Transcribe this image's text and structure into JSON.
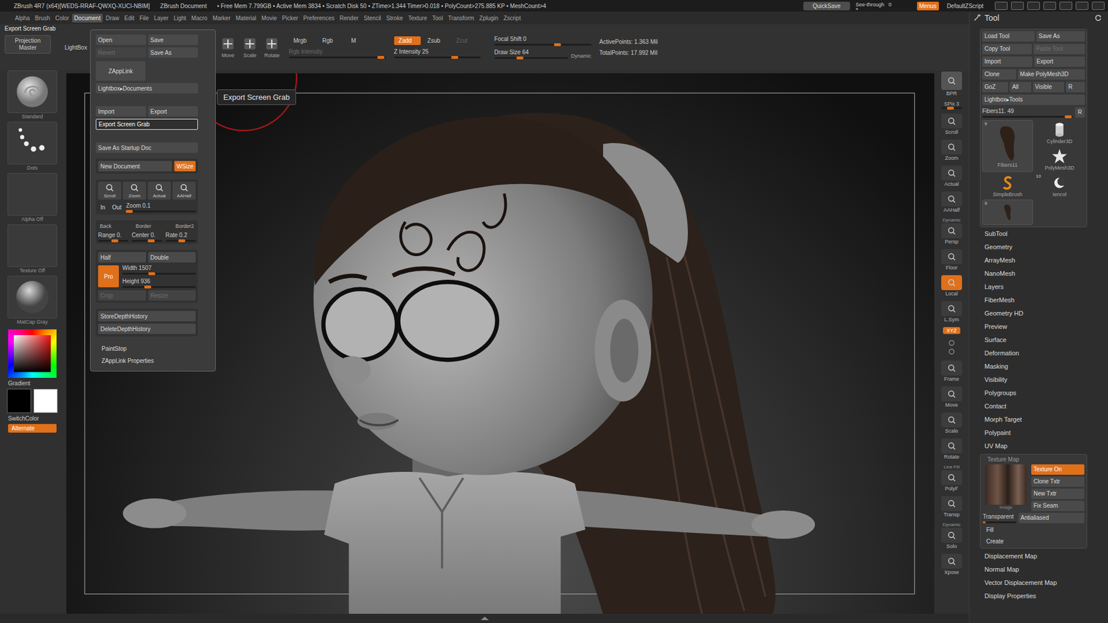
{
  "title_bar": {
    "app": "ZBrush 4R7 (x64)[WEDS-RRAF-QWXQ-XUCI-NBIM]",
    "document": "ZBrush Document",
    "stats": "• Free Mem 7.799GB • Active Mem 3834 • Scratch Disk 50 • ZTime>1.344 Timer>0.018 • PolyCount>275.885 KP • MeshCount>4",
    "quicksave": "QuickSave",
    "see_through": {
      "label": "See-through",
      "value": "0",
      "level": 0.05
    },
    "menus": {
      "label": "Menus",
      "on": true
    },
    "script": "DefaultZScript"
  },
  "menu_bar": [
    {
      "label": "Alpha",
      "selected": false
    },
    {
      "label": "Brush",
      "selected": false
    },
    {
      "label": "Color",
      "selected": false
    },
    {
      "label": "Document",
      "selected": true
    },
    {
      "label": "Draw",
      "selected": false
    },
    {
      "label": "Edit",
      "selected": false
    },
    {
      "label": "File",
      "selected": false
    },
    {
      "label": "Layer",
      "selected": false
    },
    {
      "label": "Light",
      "selected": false
    },
    {
      "label": "Macro",
      "selected": false
    },
    {
      "label": "Marker",
      "selected": false
    },
    {
      "label": "Material",
      "selected": false
    },
    {
      "label": "Movie",
      "selected": false
    },
    {
      "label": "Picker",
      "selected": false
    },
    {
      "label": "Preferences",
      "selected": false
    },
    {
      "label": "Render",
      "selected": false
    },
    {
      "label": "Stencil",
      "selected": false
    },
    {
      "label": "Stroke",
      "selected": false
    },
    {
      "label": "Texture",
      "selected": false
    },
    {
      "label": "Tool",
      "selected": false
    },
    {
      "label": "Transform",
      "selected": false
    },
    {
      "label": "Zplugin",
      "selected": false
    },
    {
      "label": "Zscript",
      "selected": false
    }
  ],
  "shelf": {
    "palette_title": "Export Screen Grab",
    "projection_master": "Projection Master",
    "lightbox": "LightBox",
    "transform_buttons": [
      {
        "label": "Move",
        "selected": false
      },
      {
        "label": "Scale",
        "selected": false
      },
      {
        "label": "Rotate",
        "selected": false
      }
    ],
    "color_modes": [
      {
        "label": "Mrgb",
        "selected": false
      },
      {
        "label": "Rgb",
        "selected": false
      },
      {
        "label": "M",
        "selected": false
      }
    ],
    "rgb_intensity": {
      "label": "Rgb Intensity",
      "disabled": true,
      "level": 0.95
    },
    "z_modes": [
      {
        "label": "Zadd",
        "selected": true,
        "disabled": false
      },
      {
        "label": "Zsub",
        "selected": false,
        "disabled": false
      },
      {
        "label": "Zcut",
        "selected": false,
        "disabled": true
      }
    ],
    "z_intensity": {
      "label": "Z Intensity",
      "value": "25",
      "level": 0.7
    },
    "focal_shift": {
      "label": "Focal Shift",
      "value": "0",
      "level": 0.65
    },
    "draw_size": {
      "label": "Draw Size",
      "value": "64",
      "level": 0.35
    },
    "dynamic": "Dynamic",
    "points": [
      "ActivePoints: 1.363 Mil",
      "TotalPoints: 17.992 Mil"
    ]
  },
  "left_shelf": {
    "items": [
      {
        "label": "Standard",
        "kind": "brush"
      },
      {
        "label": "Dots",
        "kind": "stroke"
      },
      {
        "label": "Alpha Off",
        "kind": "empty"
      },
      {
        "label": "Texture Off",
        "kind": "empty"
      },
      {
        "label": "MatCap Gray",
        "kind": "material"
      }
    ],
    "gradient": "Gradient",
    "main_color": "#000000",
    "secondary_color": "#ffffff",
    "switch_color": "SwitchColor",
    "alternate": {
      "label": "Alternate",
      "on": true
    }
  },
  "canvas": {
    "tooltip": "Export Screen Grab"
  },
  "right_bar": [
    {
      "label": "BPR",
      "kind": "big",
      "on": false
    },
    {
      "label": "SPix 3",
      "kind": "slider",
      "level": 0.45
    },
    {
      "label": "Scroll",
      "kind": "button",
      "on": false
    },
    {
      "label": "Zoom",
      "kind": "button",
      "on": false
    },
    {
      "label": "Actual",
      "kind": "button",
      "on": false
    },
    {
      "label": "AAHalf",
      "kind": "button",
      "on": false
    },
    {
      "top": "Dynamic",
      "label": "Persp",
      "kind": "button",
      "on": false
    },
    {
      "label": "Floor",
      "kind": "button",
      "on": false
    },
    {
      "label": "Local",
      "kind": "button",
      "on": true
    },
    {
      "label": "L.Sym",
      "kind": "button",
      "on": false
    },
    {
      "label": "XYZ",
      "kind": "pill",
      "on": true
    },
    {
      "kind": "icons",
      "on": false
    },
    {
      "label": "Frame",
      "kind": "button",
      "on": false
    },
    {
      "label": "Move",
      "kind": "button",
      "on": false
    },
    {
      "label": "Scale",
      "kind": "button",
      "on": false
    },
    {
      "label": "Rotate",
      "kind": "button",
      "on": false
    },
    {
      "top": "Line Fill",
      "label": "PolyF",
      "kind": "button",
      "on": false
    },
    {
      "label": "Transp",
      "kind": "button",
      "on": false
    },
    {
      "top": "Dynamic",
      "label": "Solo",
      "kind": "button",
      "on": false
    },
    {
      "label": "Xpose",
      "kind": "button",
      "on": false
    }
  ],
  "document_menu": {
    "file_buttons": [
      {
        "label": "Open",
        "disabled": false
      },
      {
        "label": "Save",
        "disabled": false
      },
      {
        "label": "Revert",
        "disabled": true
      },
      {
        "label": "Save As",
        "disabled": false
      }
    ],
    "zapplink": "ZAppLink",
    "lightbox": "Lightbox▸Documents",
    "io_buttons": [
      "Import",
      "Export"
    ],
    "export_screen_grab": {
      "label": "Export Screen Grab",
      "highlighted": true
    },
    "startup": "Save As Startup Doc",
    "new_document": "New Document",
    "wsize": {
      "label": "WSize",
      "on": true
    },
    "view_buttons": [
      "Scroll",
      "Zoom",
      "Actual",
      "AAHalf"
    ],
    "zoom_in": "In",
    "zoom_out": "Out",
    "zoom": {
      "label": "Zoom",
      "value": "0.1",
      "level": 0.05
    },
    "border_labels": [
      "Back",
      "Border",
      "Border2"
    ],
    "range_sliders": [
      {
        "label": "Range",
        "value": "0.",
        "level": 0.55
      },
      {
        "label": "Center",
        "value": "0.",
        "level": 0.65
      },
      {
        "label": "Rate",
        "value": "0.2",
        "level": 0.55
      }
    ],
    "half_double": [
      "Half",
      "Double"
    ],
    "pro": {
      "label": "Pro",
      "on": true
    },
    "size_sliders": [
      {
        "label": "Width",
        "value": "1507",
        "level": 0.4
      },
      {
        "label": "Height",
        "value": "936",
        "level": 0.35
      }
    ],
    "crop_resize": [
      {
        "label": "Crop",
        "disabled": true
      },
      {
        "label": "Resize",
        "disabled": true
      }
    ],
    "depth_buttons": [
      "StoreDepthHistory",
      "DeleteDepthHistory"
    ],
    "links": [
      "PaintStop",
      "ZAppLink Properties"
    ]
  },
  "tool_panel": {
    "title": "Tool",
    "button_rows": [
      [
        {
          "label": "Load Tool",
          "disabled": false
        },
        {
          "label": "Save As",
          "disabled": false
        }
      ],
      [
        {
          "label": "Copy Tool",
          "disabled": false
        },
        {
          "label": "Paste Tool",
          "disabled": true
        }
      ],
      [
        {
          "label": "Import",
          "disabled": false
        },
        {
          "label": "Export",
          "disabled": false
        }
      ],
      [
        {
          "label": "Clone",
          "disabled": false
        },
        {
          "label": "Make PolyMesh3D",
          "disabled": false
        }
      ],
      [
        {
          "label": "GoZ",
          "disabled": false
        },
        {
          "label": "All",
          "disabled": false
        },
        {
          "label": "Visible",
          "disabled": false
        },
        {
          "label": "R",
          "disabled": false
        }
      ]
    ],
    "lightbox": "Lightbox▸Tools",
    "current": {
      "label": "Fibers11. 49",
      "level": 0.95,
      "reset": "R"
    },
    "thumbnails": [
      {
        "name": "Fibers11",
        "badge": "9",
        "kind": "hair"
      },
      {
        "name": "Cylinder3D",
        "kind": "cylinder"
      },
      {
        "name": "PolyMesh3D",
        "kind": "star"
      },
      {
        "name": "SimpleBrush",
        "kind": "brush"
      },
      {
        "name": "Iencol",
        "badge": "10",
        "kind": "crescent"
      },
      {
        "badge": "9",
        "kind": "hair"
      }
    ],
    "subpalettes": [
      "SubTool",
      "Geometry",
      "ArrayMesh",
      "NanoMesh",
      "Layers",
      "FiberMesh",
      "Geometry HD",
      "Preview",
      "Surface",
      "Deformation",
      "Masking",
      "Visibility",
      "Polygroups",
      "Contact",
      "Morph Target",
      "Polypaint",
      "UV Map"
    ],
    "texture_map": {
      "title": "Texture Map",
      "image_label": "Image",
      "buttons": [
        {
          "label": "Texture On",
          "on": true
        },
        {
          "label": "Clone Txtr",
          "on": false
        },
        {
          "label": "New Txtr",
          "on": false
        },
        {
          "label": "Fix Seam",
          "on": false
        }
      ],
      "transparent": {
        "label": "Transparent",
        "level": 0.08
      },
      "antialiased": {
        "label": "Antialiased",
        "on": false
      },
      "actions": [
        "Fill",
        "Create"
      ]
    },
    "more_subpalettes": [
      "Displacement Map",
      "Normal Map",
      "Vector Displacement Map",
      "Display Properties"
    ]
  }
}
